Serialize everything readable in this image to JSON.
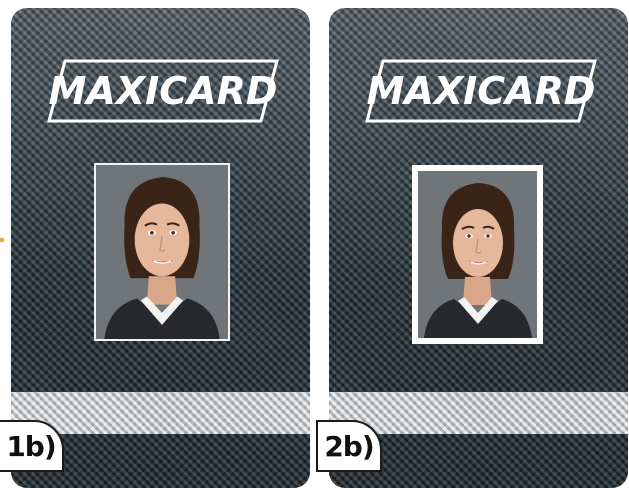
{
  "cards": [
    {
      "logo_text": "MAXICARD",
      "label": "1b)"
    },
    {
      "logo_text": "MAXICARD",
      "label": "2b)"
    }
  ],
  "colors": {
    "card_base": "#2b3a44",
    "silver_band": "#c9cdcf",
    "photo_background": "#6e7478",
    "photo_border": "#ffffff",
    "accent_mark": "#f0a020"
  }
}
